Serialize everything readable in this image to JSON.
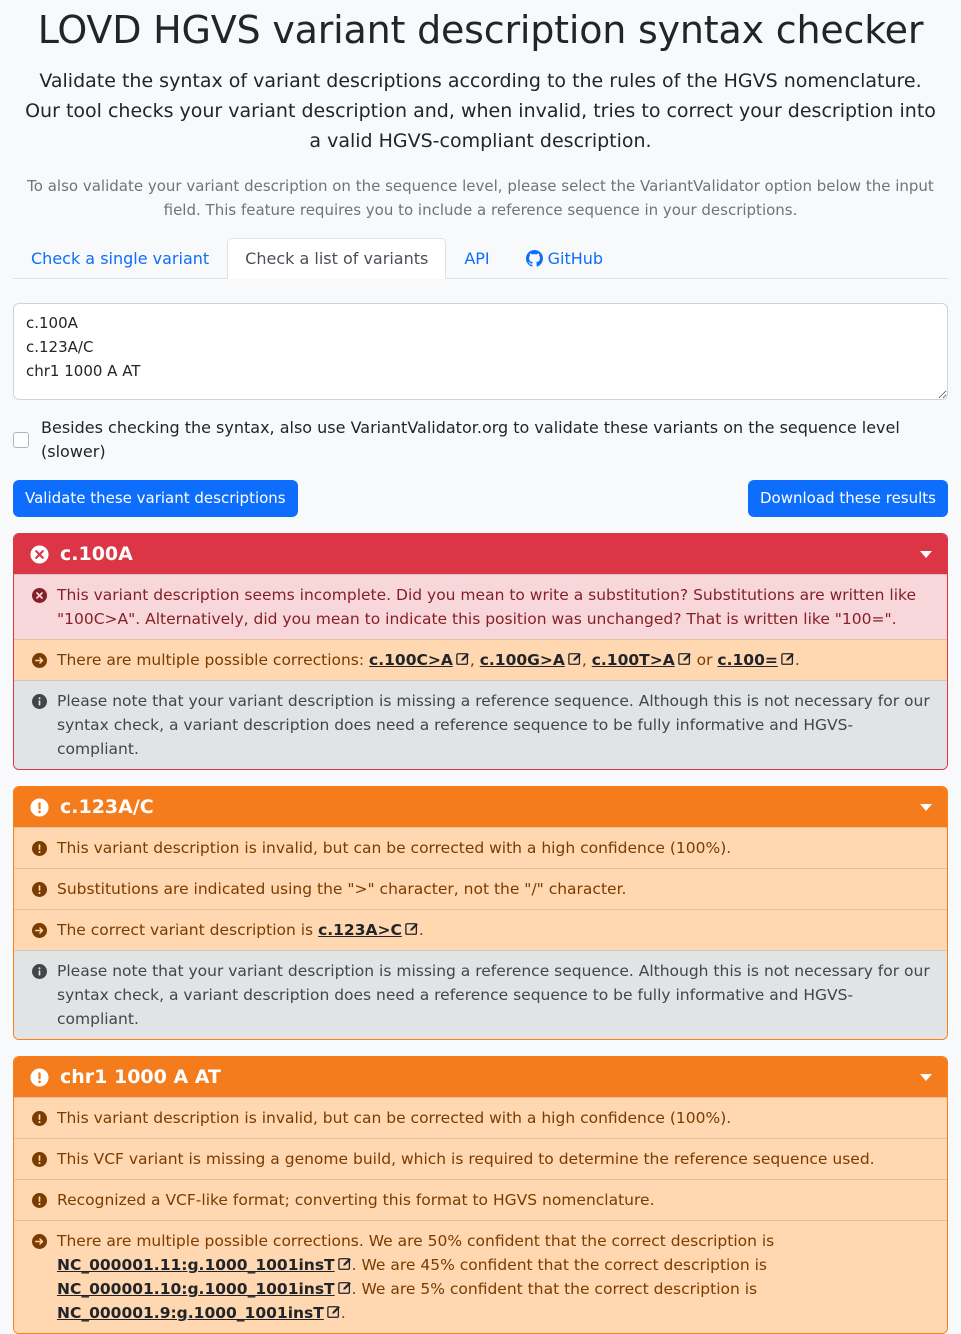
{
  "header": {
    "title": "LOVD HGVS variant description syntax checker",
    "lead": "Validate the syntax of variant descriptions according to the rules of the HGVS nomenclature. Our tool checks your variant description and, when invalid, tries to correct your description into a valid HGVS-compliant description.",
    "note": "To also validate your variant description on the sequence level, please select the VariantValidator option below the input field. This feature requires you to include a reference sequence in your descriptions."
  },
  "tabs": [
    {
      "label": "Check a single variant"
    },
    {
      "label": "Check a list of variants"
    },
    {
      "label": "API"
    },
    {
      "label": "GitHub"
    }
  ],
  "input": {
    "value": "c.100A\nc.123A/C\nchr1 1000 A AT"
  },
  "option": {
    "label": "Besides checking the syntax, also use VariantValidator.org to validate these variants on the sequence level (slower)"
  },
  "buttons": {
    "validate": "Validate these variant descriptions",
    "download": "Download these results"
  },
  "results": {
    "r1": {
      "title": "c.100A",
      "m1": "This variant description seems incomplete. Did you mean to write a substitution? Substitutions are written like \"100C>A\". Alternatively, did you mean to indicate this position was unchanged? That is written like \"100=\".",
      "m2_prefix": "There are multiple possible corrections: ",
      "s1": "c.100C>A",
      "s2": "c.100G>A",
      "s3": "c.100T>A",
      "s4": "c.100=",
      "sep1": ", ",
      "sep2": ", ",
      "sep3": " or ",
      "end": ".",
      "m3": "Please note that your variant description is missing a reference sequence. Although this is not necessary for our syntax check, a variant description does need a reference sequence to be fully informative and HGVS-compliant."
    },
    "r2": {
      "title": "c.123A/C",
      "m1": "This variant description is invalid, but can be corrected with a high confidence (100%).",
      "m2": "Substitutions are indicated using the \">\" character, not the \"/\" character.",
      "m3_prefix": "The correct variant description is ",
      "s1": "c.123A>C",
      "end": ".",
      "m4": "Please note that your variant description is missing a reference sequence. Although this is not necessary for our syntax check, a variant description does need a reference sequence to be fully informative and HGVS-compliant."
    },
    "r3": {
      "title": "chr1 1000 A AT",
      "m1": "This variant description is invalid, but can be corrected with a high confidence (100%).",
      "m2": "This VCF variant is missing a genome build, which is required to determine the reference sequence used.",
      "m3": "Recognized a VCF-like format; converting this format to HGVS nomenclature.",
      "m4_prefix": "There are multiple possible corrections. We are 50% confident that the correct description is ",
      "s1": "NC_000001.11:g.1000_1001insT",
      "t1": ". We are 45% confident that the correct description is ",
      "s2": "NC_000001.10:g.1000_1001insT",
      "t2": ". We are 5% confident that the correct description is ",
      "s3": "NC_000001.9:g.1000_1001insT",
      "end": "."
    }
  }
}
